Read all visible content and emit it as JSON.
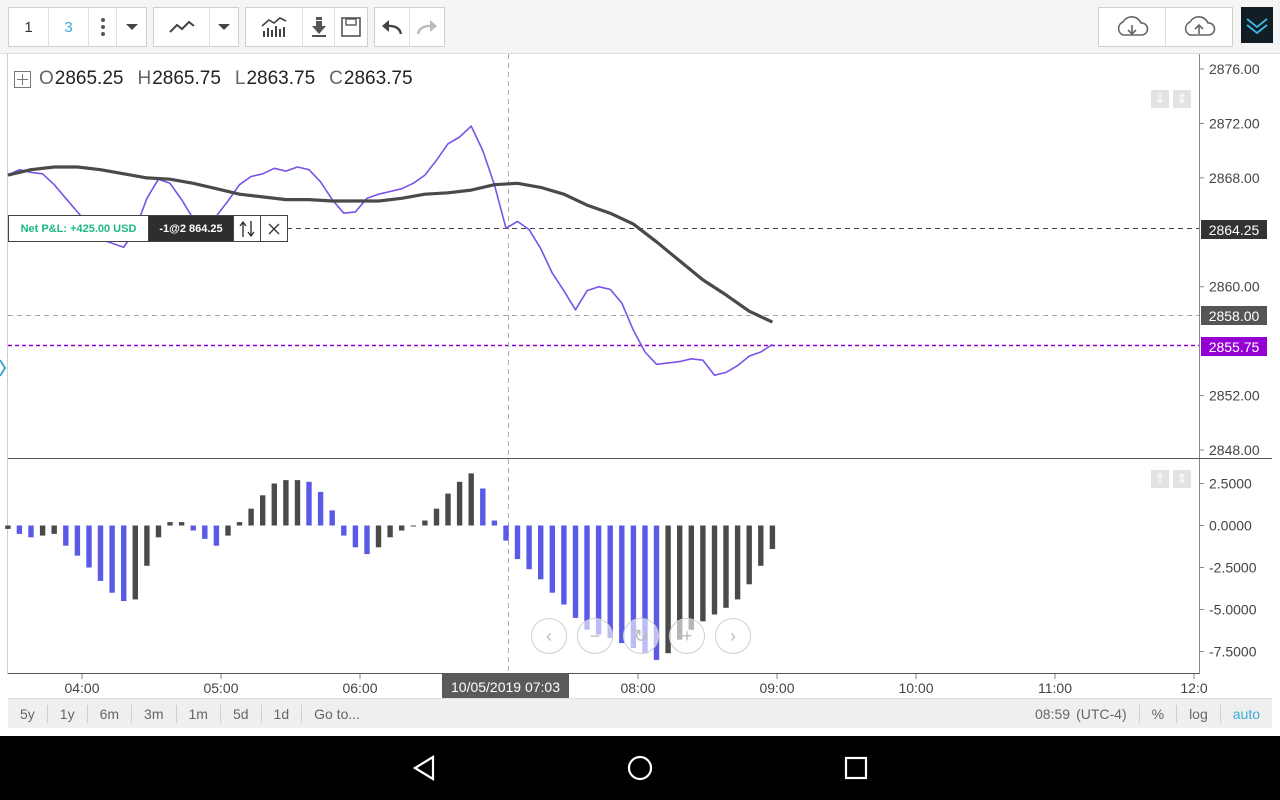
{
  "toolbar": {
    "layout_label": "1",
    "studies_count": "3",
    "icons": [
      "more-vertical-icon",
      "dropdown-arrow-icon",
      "line-chart-icon",
      "dropdown-arrow-icon",
      "indicators-icon",
      "download-icon",
      "save-icon",
      "undo-icon",
      "redo-icon",
      "cloud-download-icon",
      "cloud-upload-icon",
      "collapse-icon"
    ]
  },
  "ohlc": {
    "o_key": "O",
    "o_val": "2865.25",
    "h_key": "H",
    "h_val": "2865.75",
    "l_key": "L",
    "l_val": "2863.75",
    "c_key": "C",
    "c_val": "2863.75"
  },
  "position": {
    "pnl": "Net P&L: +425.00 USD",
    "order": "-1@2 864.25",
    "reverse_icon": "reverse-arrows-icon",
    "close_icon": "close-icon"
  },
  "price_axis": {
    "ticks": [
      "2876.00",
      "2872.00",
      "2868.00",
      "2864.25",
      "2860.00",
      "2858.00",
      "2855.75",
      "2852.00",
      "2848.00"
    ],
    "tag_current": "2864.25",
    "tag_crosshair": "2858.00",
    "tag_last": "2855.75",
    "colors": {
      "current": "#333333",
      "crosshair": "#555555",
      "last": "#9400d3"
    }
  },
  "osc_axis": {
    "ticks": [
      "2.5000",
      "0.0000",
      "-2.5000",
      "-5.0000",
      "-7.5000"
    ]
  },
  "time_axis": {
    "ticks": [
      "04:00",
      "05:00",
      "06:00",
      "07:00",
      "08:00",
      "09:00",
      "10:00",
      "11:00",
      "12:0"
    ],
    "crosshair_label": "10/05/2019 07:03"
  },
  "range_bar": {
    "ranges": [
      "5y",
      "1y",
      "6m",
      "3m",
      "1m",
      "5d",
      "1d"
    ],
    "goto": "Go to...",
    "time": "08:59",
    "tz": "(UTC-4)",
    "percent": "%",
    "log": "log",
    "auto": "auto"
  },
  "nav_icons": [
    "chevron-left-icon",
    "zoom-out-icon",
    "reset-icon",
    "zoom-in-icon",
    "chevron-right-icon"
  ],
  "chart_data": [
    {
      "type": "line",
      "series": [
        {
          "color": "#7b52e8",
          "x": [
            "03:28",
            "03:33",
            "03:38",
            "03:43",
            "03:48",
            "03:53",
            "03:58",
            "04:03",
            "04:08",
            "04:13",
            "04:18",
            "04:23",
            "04:28",
            "04:33",
            "04:38",
            "04:43",
            "04:48",
            "04:53",
            "04:58",
            "05:03",
            "05:08",
            "05:13",
            "05:18",
            "05:23",
            "05:28",
            "05:33",
            "05:38",
            "05:43",
            "05:48",
            "05:53",
            "05:58",
            "06:03",
            "06:08",
            "06:13",
            "06:18",
            "06:23",
            "06:28",
            "06:33",
            "06:38",
            "06:43",
            "06:48",
            "06:53",
            "06:58",
            "07:03",
            "07:08",
            "07:13",
            "07:18",
            "07:23",
            "07:28",
            "07:33",
            "07:38",
            "07:43",
            "07:48",
            "07:53",
            "07:58",
            "08:03",
            "08:08",
            "08:13",
            "08:18",
            "08:23",
            "08:28",
            "08:33",
            "08:38",
            "08:43",
            "08:48",
            "08:53",
            "08:58"
          ],
          "values": [
            2868.2,
            2868.6,
            2868.4,
            2868.3,
            2867.5,
            2866.5,
            2865.5,
            2864.5,
            2863.5,
            2863.2,
            2862.9,
            2864.2,
            2866.5,
            2867.9,
            2867.6,
            2866.4,
            2865.0,
            2864.5,
            2865.2,
            2866.3,
            2867.5,
            2868.1,
            2868.3,
            2868.7,
            2868.5,
            2868.8,
            2868.6,
            2867.7,
            2866.4,
            2865.4,
            2865.5,
            2866.5,
            2866.8,
            2867.0,
            2867.2,
            2867.6,
            2868.2,
            2869.3,
            2870.5,
            2871.0,
            2871.8,
            2870.0,
            2867.5,
            2864.3,
            2864.8,
            2864.2,
            2862.8,
            2861.0,
            2859.7,
            2858.3,
            2859.7,
            2860.0,
            2859.8,
            2858.8,
            2856.8,
            2855.2,
            2854.3,
            2854.4,
            2854.5,
            2854.7,
            2854.6,
            2853.5,
            2853.7,
            2854.2,
            2854.9,
            2855.2,
            2855.75
          ]
        },
        {
          "color": "#4a4a4a",
          "x": [
            "03:28",
            "03:38",
            "03:48",
            "03:58",
            "04:08",
            "04:18",
            "04:28",
            "04:38",
            "04:48",
            "04:58",
            "05:08",
            "05:18",
            "05:28",
            "05:38",
            "05:48",
            "05:58",
            "06:08",
            "06:18",
            "06:28",
            "06:38",
            "06:48",
            "06:58",
            "07:08",
            "07:18",
            "07:28",
            "07:38",
            "07:48",
            "07:58",
            "08:08",
            "08:18",
            "08:28",
            "08:38",
            "08:48",
            "08:58"
          ],
          "values": [
            2868.2,
            2868.6,
            2868.8,
            2868.8,
            2868.6,
            2868.3,
            2868.0,
            2867.9,
            2867.6,
            2867.2,
            2866.8,
            2866.6,
            2866.4,
            2866.4,
            2866.3,
            2866.3,
            2866.3,
            2866.5,
            2866.8,
            2866.9,
            2867.1,
            2867.5,
            2867.6,
            2867.3,
            2866.8,
            2866.0,
            2865.4,
            2864.6,
            2863.3,
            2861.9,
            2860.5,
            2859.4,
            2858.2,
            2857.4
          ]
        }
      ],
      "ylim": [
        2848.0,
        2876.0
      ],
      "xlim": [
        "03:28",
        "12:00"
      ],
      "grid": false
    },
    {
      "type": "bar",
      "x": [
        "03:28",
        "03:33",
        "03:38",
        "03:43",
        "03:48",
        "03:53",
        "03:58",
        "04:03",
        "04:08",
        "04:13",
        "04:18",
        "04:23",
        "04:28",
        "04:33",
        "04:38",
        "04:43",
        "04:48",
        "04:53",
        "04:58",
        "05:03",
        "05:08",
        "05:13",
        "05:18",
        "05:23",
        "05:28",
        "05:33",
        "05:38",
        "05:43",
        "05:48",
        "05:53",
        "05:58",
        "06:03",
        "06:08",
        "06:13",
        "06:18",
        "06:23",
        "06:28",
        "06:33",
        "06:38",
        "06:43",
        "06:48",
        "06:53",
        "06:58",
        "07:03",
        "07:08",
        "07:13",
        "07:18",
        "07:23",
        "07:28",
        "07:33",
        "07:38",
        "07:43",
        "07:48",
        "07:53",
        "07:58",
        "08:03",
        "08:08",
        "08:13",
        "08:18",
        "08:23",
        "08:28",
        "08:33",
        "08:38",
        "08:43",
        "08:48",
        "08:53",
        "08:58"
      ],
      "values": [
        -0.2,
        -0.5,
        -0.7,
        -0.6,
        -0.5,
        -1.2,
        -1.8,
        -2.5,
        -3.3,
        -4.0,
        -4.5,
        -4.4,
        -2.4,
        -0.7,
        0.2,
        0.2,
        -0.3,
        -0.8,
        -1.2,
        -0.6,
        0.2,
        1.0,
        1.8,
        2.5,
        2.7,
        2.7,
        2.6,
        2.0,
        0.9,
        -0.6,
        -1.3,
        -1.7,
        -1.3,
        -0.7,
        -0.3,
        0.0,
        0.3,
        1.0,
        1.9,
        2.6,
        3.1,
        2.2,
        0.3,
        -0.9,
        -2.0,
        -2.6,
        -3.2,
        -4.0,
        -4.7,
        -5.5,
        -6.2,
        -6.5,
        -6.7,
        -7.0,
        -7.3,
        -7.6,
        -8.0,
        -7.6,
        -6.8,
        -6.2,
        -5.7,
        -5.3,
        -4.9,
        -4.4,
        -3.5,
        -2.4,
        -1.4
      ],
      "colors": {
        "rising": "#4a4a4a",
        "falling": "#5a5ae6"
      },
      "ylim": [
        -8.5,
        3.5
      ],
      "grid": false
    }
  ]
}
